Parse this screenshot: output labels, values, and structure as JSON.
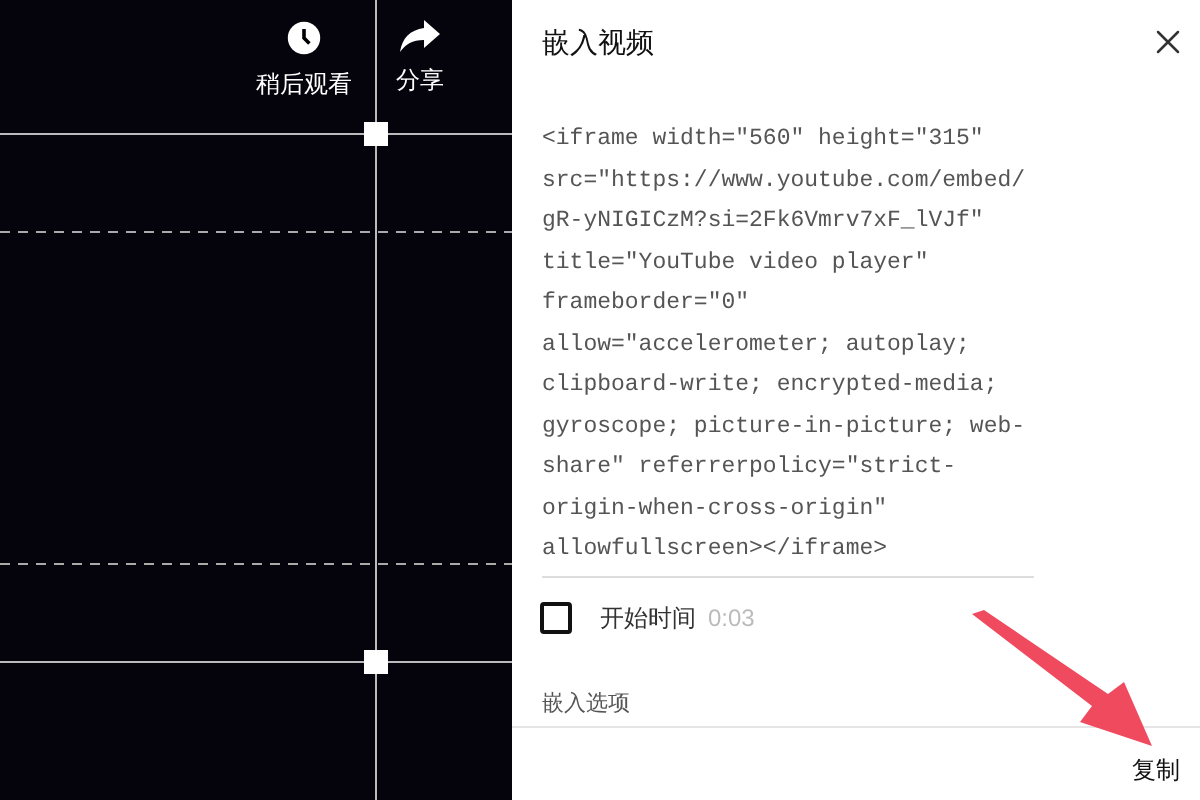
{
  "video_actions": [
    {
      "kind": "clock",
      "label": "稍后观看"
    },
    {
      "kind": "share",
      "label": "分享"
    }
  ],
  "dialog": {
    "title": "嵌入视频",
    "embed_code": "<iframe width=\"560\" height=\"315\" src=\"https://www.youtube.com/embed/gR-yNIGICzM?si=2Fk6Vmrv7xF_lVJf\" title=\"YouTube video player\" frameborder=\"0\" allow=\"accelerometer; autoplay; clipboard-write; encrypted-media; gyroscope; picture-in-picture; web-share\" referrerpolicy=\"strict-origin-when-cross-origin\" allowfullscreen></iframe>",
    "start_time": {
      "label": "开始时间",
      "value": "0:03",
      "checked": false
    },
    "options_heading": "嵌入选项",
    "copy_button": "复制"
  }
}
